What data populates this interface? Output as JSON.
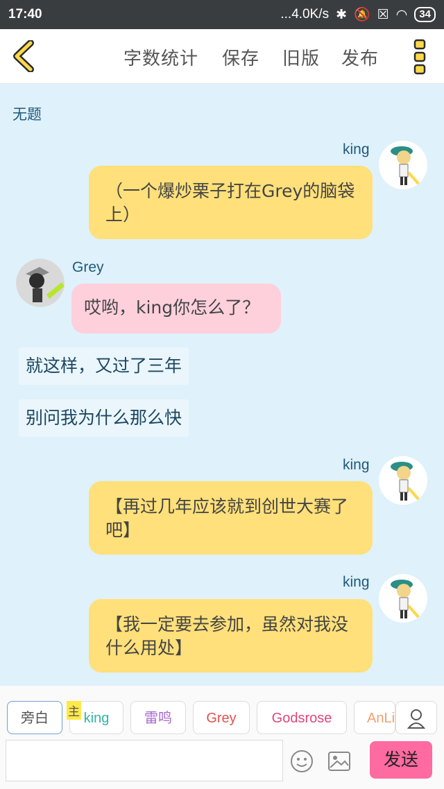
{
  "status": {
    "time": "17:40",
    "net": "...4.0K/s",
    "battery": "34"
  },
  "toolbar": {
    "items": [
      "字数统计",
      "保存",
      "旧版",
      "发布"
    ]
  },
  "chat": {
    "title": "无题",
    "messages": [
      {
        "speaker": "king",
        "text": "（一个爆炒栗子打在Grey的脑袋上）"
      },
      {
        "speaker": "Grey",
        "text": "哎哟，king你怎么了？"
      },
      {
        "narration": "就这样，又过了三年"
      },
      {
        "narration": "别问我为什么那么快"
      },
      {
        "speaker": "king",
        "text": "【再过几年应该就到创世大赛了吧】"
      },
      {
        "speaker": "king",
        "text": "【我一定要去参加，虽然对我没什么用处】"
      }
    ]
  },
  "roles": {
    "narrator": "旁白",
    "host_badge": "主",
    "chips": [
      "king",
      "雷鸣",
      "Grey",
      "Godsrose",
      "AnLi"
    ],
    "chip_colors": [
      "#2fb3a6",
      "#a86bd0",
      "#e05252",
      "#e0457a",
      "#f0a070"
    ]
  },
  "composer": {
    "send": "发送"
  }
}
